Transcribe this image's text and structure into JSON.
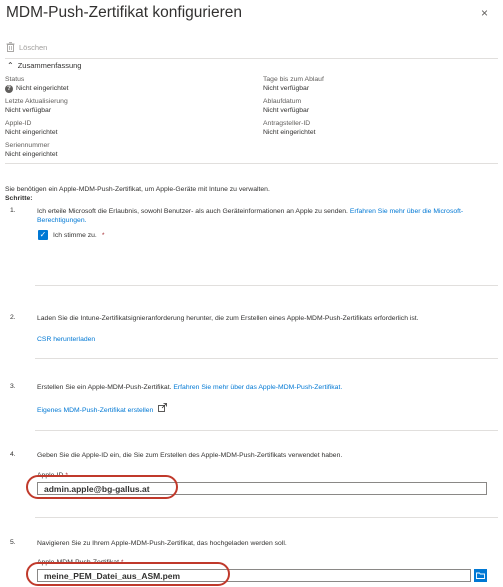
{
  "header": {
    "title": "MDM-Push-Zertifikat konfigurieren",
    "close_glyph": "×"
  },
  "toolbar": {
    "delete_label": "Löschen",
    "delete_icon": "trash-icon"
  },
  "summary": {
    "toggle_label": "Zusammenfassung",
    "left": [
      {
        "label": "Status",
        "value": "Nicht eingerichtet",
        "icon": "question-icon"
      },
      {
        "label": "Letzte Aktualisierung",
        "value": "Nicht verfügbar"
      },
      {
        "label": "Apple-ID",
        "value": "Nicht eingerichtet"
      },
      {
        "label": "Seriennummer",
        "value": "Nicht eingerichtet"
      }
    ],
    "right": [
      {
        "label": "Tage bis zum Ablauf",
        "value": "Nicht verfügbar"
      },
      {
        "label": "Ablaufdatum",
        "value": "Nicht verfügbar"
      },
      {
        "label": "Antragsteller-ID",
        "value": "Nicht eingerichtet"
      }
    ]
  },
  "intro": {
    "text": "Sie benötigen ein Apple-MDM-Push-Zertifikat, um Apple-Geräte mit Intune zu verwalten.",
    "steps_label": "Schritte:"
  },
  "steps": [
    {
      "number": "1.",
      "text": "Ich erteile Microsoft die Erlaubnis, sowohl Benutzer- als auch Geräteinformationen an Apple zu senden.",
      "link": "Erfahren Sie mehr über die Microsoft-Berechtigungen.",
      "checkbox_label": "Ich stimme zu.",
      "required_mark": "*"
    },
    {
      "number": "2.",
      "text": "Laden Sie die Intune-Zertifikatsignieranforderung herunter, die zum Erstellen eines Apple-MDM-Push-Zertifikats erforderlich ist.",
      "link": "CSR herunterladen"
    },
    {
      "number": "3.",
      "text": "Erstellen Sie ein Apple-MDM-Push-Zertifikat.",
      "link_inline": "Erfahren Sie mehr über das Apple-MDM-Push-Zertifikat.",
      "link": "Eigenes MDM-Push-Zertifikat erstellen"
    },
    {
      "number": "4.",
      "text": "Geben Sie die Apple-ID ein, die Sie zum Erstellen des Apple-MDM-Push-Zertifikats verwendet haben.",
      "field_label": "Apple-ID",
      "required_mark": "*",
      "field_value": "admin.apple@bg-gallus.at"
    },
    {
      "number": "5.",
      "text": "Navigieren Sie zu Ihrem Apple-MDM-Push-Zertifikat, das hochgeladen werden soll.",
      "field_label": "Apple-MDM-Push-Zertifikat",
      "required_mark": "*",
      "field_value": "meine_PEM_Datei_aus_ASM.pem",
      "browse_icon": "folder-icon"
    }
  ],
  "colors": {
    "accent": "#0078d4",
    "annotation": "#c0392b",
    "required": "#a4262c"
  }
}
